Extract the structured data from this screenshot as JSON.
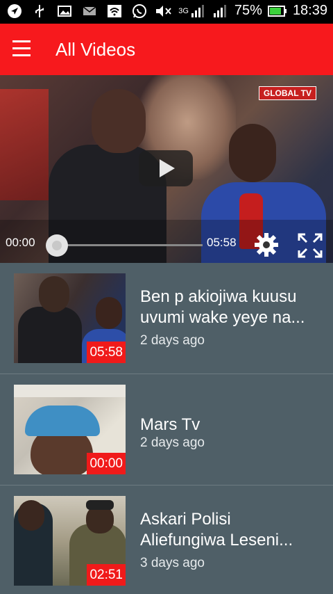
{
  "status_bar": {
    "battery": "75%",
    "time": "18:39",
    "network_type": "3G",
    "icons": [
      "navigation-icon",
      "usb-icon",
      "image-icon",
      "mail-icon",
      "wifi-icon",
      "whatsapp-icon",
      "mute-icon",
      "signal-icon",
      "battery-icon"
    ]
  },
  "app_bar": {
    "title": "All Videos",
    "menu_icon": "hamburger-menu-icon"
  },
  "player": {
    "current_time": "00:00",
    "total_time": "05:58",
    "progress": 0,
    "channel_tag": "GLOBAL TV",
    "controls": [
      "play-icon",
      "settings-gear-icon",
      "fullscreen-icon"
    ]
  },
  "videos": [
    {
      "title": "Ben p akiojiwa kuusu uvumi wake yeye na...",
      "title_line1": "Ben p akiojiwa kuusu",
      "title_line2": "uvumi wake yeye na...",
      "age": "2 days ago",
      "duration": "05:58"
    },
    {
      "title": "Mars Tv",
      "title_line1": "Mars Tv",
      "title_line2": "",
      "age": "2 days ago",
      "duration": "00:00"
    },
    {
      "title": "Askari Polisi Aliefungiwa Leseni...",
      "title_line1": "Askari Polisi",
      "title_line2": "Aliefungiwa Leseni...",
      "age": "3 days ago",
      "duration": "02:51"
    }
  ],
  "colors": {
    "app_bar": "#f7191d",
    "list_background": "#4f5f67",
    "duration_badge": "#f01a1a"
  }
}
